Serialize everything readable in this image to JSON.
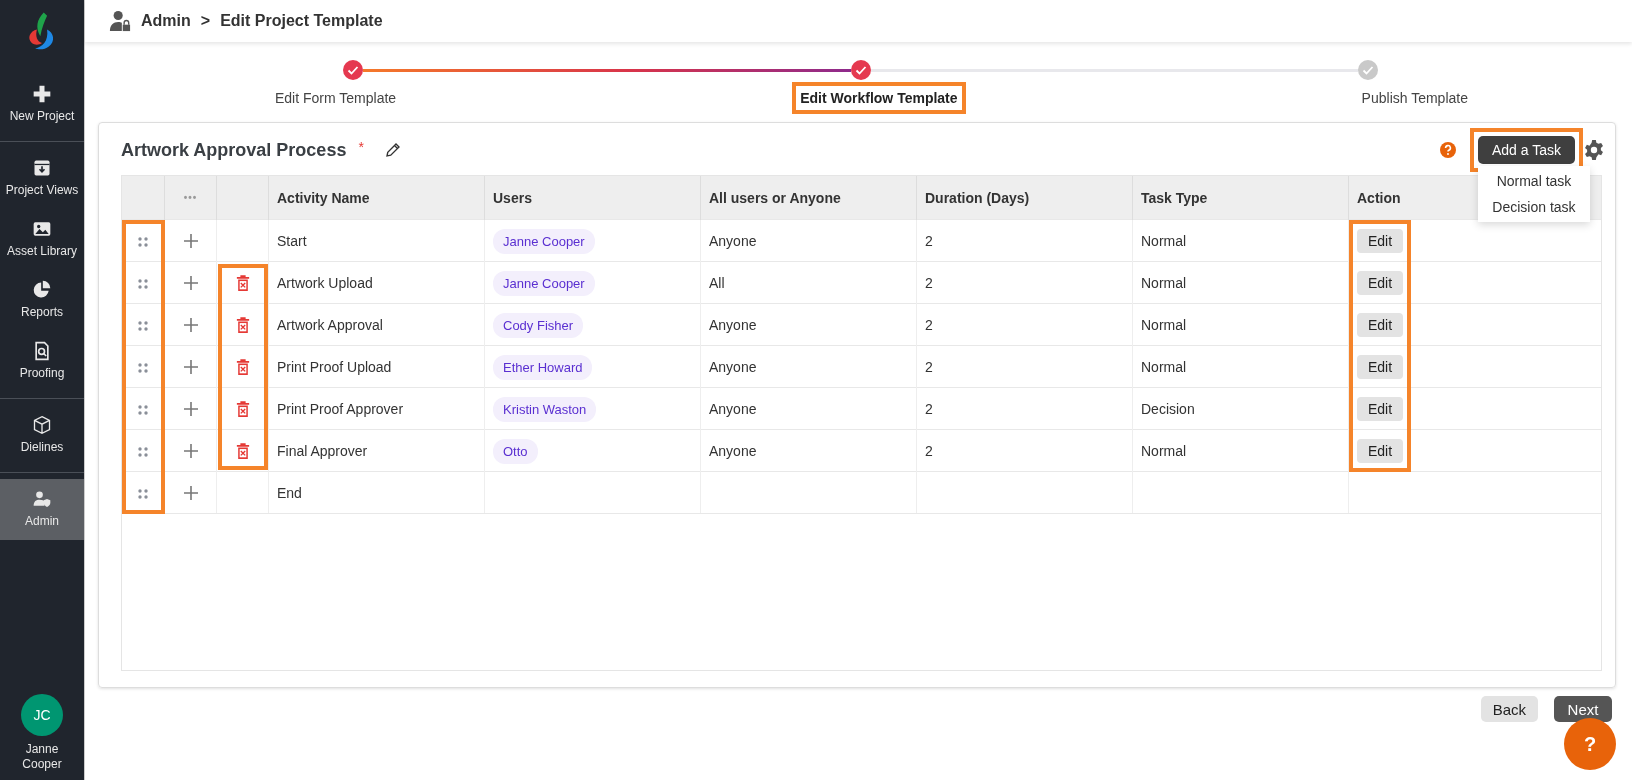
{
  "sidebar": {
    "items": [
      {
        "label": "New Project",
        "selected": false,
        "divider_after": true
      },
      {
        "label": "Project Views",
        "selected": false,
        "divider_after": false
      },
      {
        "label": "Asset Library",
        "selected": false,
        "divider_after": false
      },
      {
        "label": "Reports",
        "selected": false,
        "divider_after": false
      },
      {
        "label": "Proofing",
        "selected": false,
        "divider_after": true
      },
      {
        "label": "Dielines",
        "selected": false,
        "divider_after": true
      },
      {
        "label": "Admin",
        "selected": true,
        "divider_after": false
      }
    ],
    "user": {
      "initials": "JC",
      "name": "Janne Cooper"
    }
  },
  "breadcrumb": {
    "parent": "Admin",
    "separator": ">",
    "current": "Edit Project Template"
  },
  "steps": [
    {
      "label": "Edit Form Template",
      "checked": true,
      "selected": false,
      "highlight": false
    },
    {
      "label": "Edit Workflow Template",
      "checked": true,
      "selected": true,
      "highlight": true
    },
    {
      "label": "Publish Template",
      "checked": false,
      "selected": false,
      "highlight": false
    }
  ],
  "process": {
    "title": "Artwork Approval Process",
    "required_mark": "*"
  },
  "add_task": {
    "label": "Add a Task",
    "highlight": true,
    "menu": [
      "Normal task",
      "Decision task"
    ]
  },
  "table": {
    "columns": [
      {
        "kind": "drag",
        "highlight": true
      },
      {
        "kind": "more",
        "label": "•••",
        "highlight": false
      },
      {
        "kind": "delete",
        "highlight": true
      },
      {
        "kind": "name",
        "label": "Activity Name",
        "highlight": false
      },
      {
        "kind": "user",
        "label": "Users",
        "highlight": false
      },
      {
        "kind": "assign",
        "label": "All users or Anyone",
        "highlight": false
      },
      {
        "kind": "duration",
        "label": "Duration (Days)",
        "highlight": false
      },
      {
        "kind": "type",
        "label": "Task Type",
        "highlight": false
      },
      {
        "kind": "action",
        "label": "Action",
        "highlight": true
      }
    ],
    "rows": [
      {
        "name": "Start",
        "user": "Janne Cooper",
        "assign": "Anyone",
        "duration": "2",
        "type": "Normal",
        "deletable": false,
        "edit": "Edit"
      },
      {
        "name": "Artwork Upload",
        "user": "Janne Cooper",
        "assign": "All",
        "duration": "2",
        "type": "Normal",
        "deletable": true,
        "edit": "Edit"
      },
      {
        "name": "Artwork Approval",
        "user": "Cody Fisher",
        "assign": "Anyone",
        "duration": "2",
        "type": "Normal",
        "deletable": true,
        "edit": "Edit"
      },
      {
        "name": "Print Proof Upload",
        "user": "Ether Howard",
        "assign": "Anyone",
        "duration": "2",
        "type": "Normal",
        "deletable": true,
        "edit": "Edit"
      },
      {
        "name": "Print Proof Approver",
        "user": "Kristin Waston",
        "assign": "Anyone",
        "duration": "2",
        "type": "Decision",
        "deletable": true,
        "edit": "Edit"
      },
      {
        "name": "Final Approver",
        "user": "Otto",
        "assign": "Anyone",
        "duration": "2",
        "type": "Normal",
        "deletable": true,
        "edit": "Edit"
      },
      {
        "name": "End",
        "deletable": false
      }
    ]
  },
  "footer": {
    "back": "Back",
    "next": "Next",
    "help": "?"
  }
}
